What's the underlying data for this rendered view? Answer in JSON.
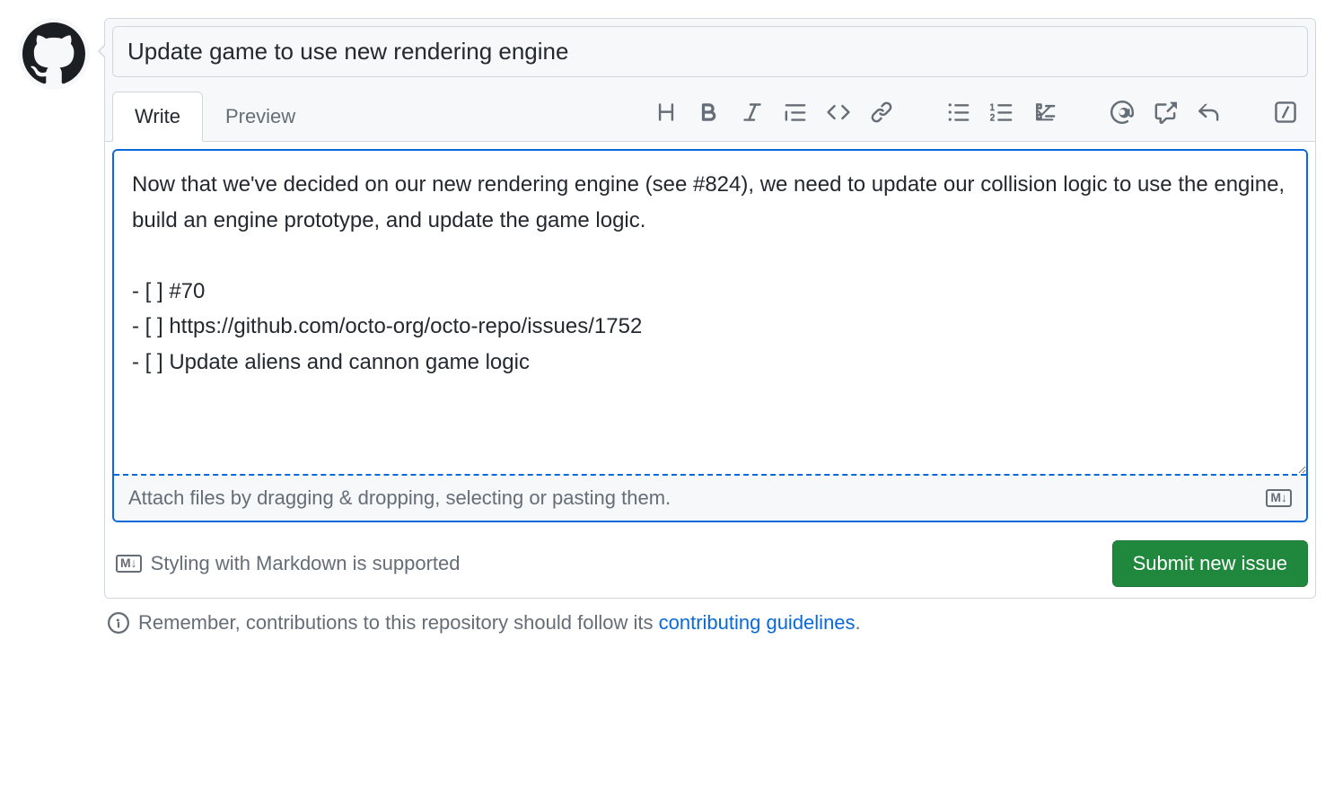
{
  "issue": {
    "title": "Update game to use new rendering engine",
    "body": "Now that we've decided on our new rendering engine (see #824), we need to update our collision logic to use the engine, build an engine prototype, and update the game logic.\n\n- [ ] #70\n- [ ] https://github.com/octo-org/octo-repo/issues/1752\n- [ ] Update aliens and cannon game logic"
  },
  "tabs": {
    "write": "Write",
    "preview": "Preview"
  },
  "attach_hint": "Attach files by dragging & dropping, selecting or pasting them.",
  "markdown_hint": "Styling with Markdown is supported",
  "submit_label": "Submit new issue",
  "notice": {
    "prefix": "Remember, contributions to this repository should follow its ",
    "link_text": "contributing guidelines",
    "suffix": "."
  },
  "md_badge": "M↓"
}
